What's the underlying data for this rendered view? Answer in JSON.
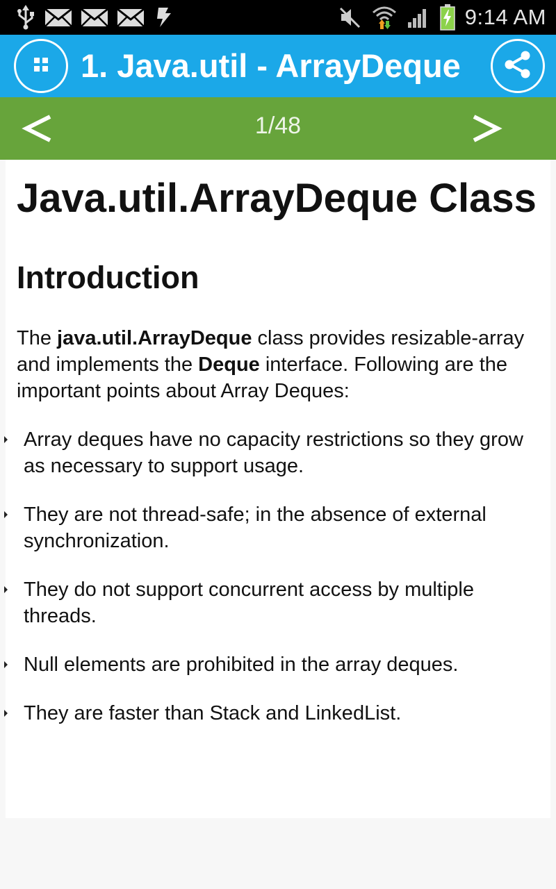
{
  "status_bar": {
    "left_icons": [
      "usb-icon",
      "mail-icon",
      "mail-icon",
      "mail-icon",
      "sync-icon"
    ],
    "right_icons": [
      "mute-icon",
      "wifi-icon",
      "signal-icon",
      "battery-icon"
    ],
    "time": "9:14 AM"
  },
  "title_bar": {
    "title": "1. Java.util - ArrayDeque",
    "menu_icon": "grid-menu-icon",
    "share_icon": "share-icon",
    "color": "#1ba8e8"
  },
  "pager": {
    "prev_label": "<",
    "next_label": ">",
    "page_indicator": "1/48",
    "color": "#67a43b"
  },
  "content": {
    "main_title": "Java.util.ArrayDeque Class",
    "section_title": "Introduction",
    "intro": {
      "part1": "The ",
      "bold1": "java.util.ArrayDeque",
      "part2": " class provides resizable-array and implements the ",
      "bold2": "Deque",
      "part3": " interface. Following are the important points about Array Deques:"
    },
    "points": [
      "Array deques have no capacity restrictions so they grow as necessary to support usage.",
      "They are not thread-safe; in the absence of external synchronization.",
      "They do not support concurrent access by multiple threads.",
      "Null elements are prohibited in the array deques.",
      "They are faster than Stack and LinkedList."
    ]
  }
}
